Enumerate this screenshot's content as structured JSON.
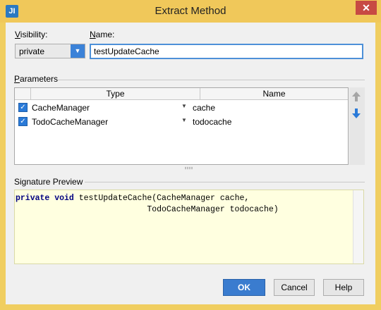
{
  "window": {
    "title": "Extract Method",
    "app_icon": "JI",
    "close_glyph": "✕"
  },
  "colors": {
    "accent": "#3b82d8",
    "titlebar": "#f0c85a",
    "close": "#c74a43",
    "preview_bg": "#ffffe0"
  },
  "visibility": {
    "label_underlined": "V",
    "label_rest": "isibility:",
    "value": "private",
    "arrow": "▼"
  },
  "name": {
    "label_underlined": "N",
    "label_rest": "ame:",
    "value": "testUpdateCache"
  },
  "parameters": {
    "label_underlined": "P",
    "label_rest": "arameters",
    "columns": [
      "Type",
      "Name"
    ],
    "rows": [
      {
        "checked": true,
        "type": "CacheManager",
        "name": "cache"
      },
      {
        "checked": true,
        "type": "TodoCacheManager",
        "name": "todocache"
      }
    ],
    "check_glyph": "✓",
    "drop_glyph": "▼",
    "move_up_icon": "arrow-up",
    "move_down_icon": "arrow-down"
  },
  "signature": {
    "label": "Signature Preview",
    "keyword1": "private",
    "keyword2": "void",
    "line1_rest": " testUpdateCache(CacheManager cache,",
    "line2": "                           TodoCacheManager todocache)"
  },
  "buttons": {
    "ok": "OK",
    "cancel": "Cancel",
    "help": "Help"
  }
}
